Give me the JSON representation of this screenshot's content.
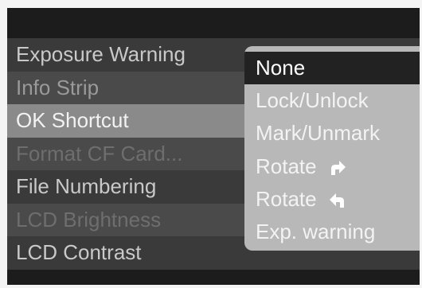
{
  "menu": {
    "items": [
      {
        "label": "Exposure Warning"
      },
      {
        "label": "Info Strip"
      },
      {
        "label": "OK Shortcut"
      },
      {
        "label": "Format CF Card..."
      },
      {
        "label": "File Numbering"
      },
      {
        "label": "LCD Brightness"
      },
      {
        "label": "LCD Contrast"
      }
    ],
    "selected_index": 2
  },
  "popup": {
    "options": [
      {
        "label": "None",
        "selected": true
      },
      {
        "label": "Lock/Unlock"
      },
      {
        "label": "Mark/Unmark"
      },
      {
        "label": "Rotate",
        "icon": "rotate-clockwise-arrow-icon"
      },
      {
        "label": "Rotate",
        "icon": "rotate-counterclockwise-arrow-icon"
      },
      {
        "label": "Exp. warning"
      }
    ]
  }
}
